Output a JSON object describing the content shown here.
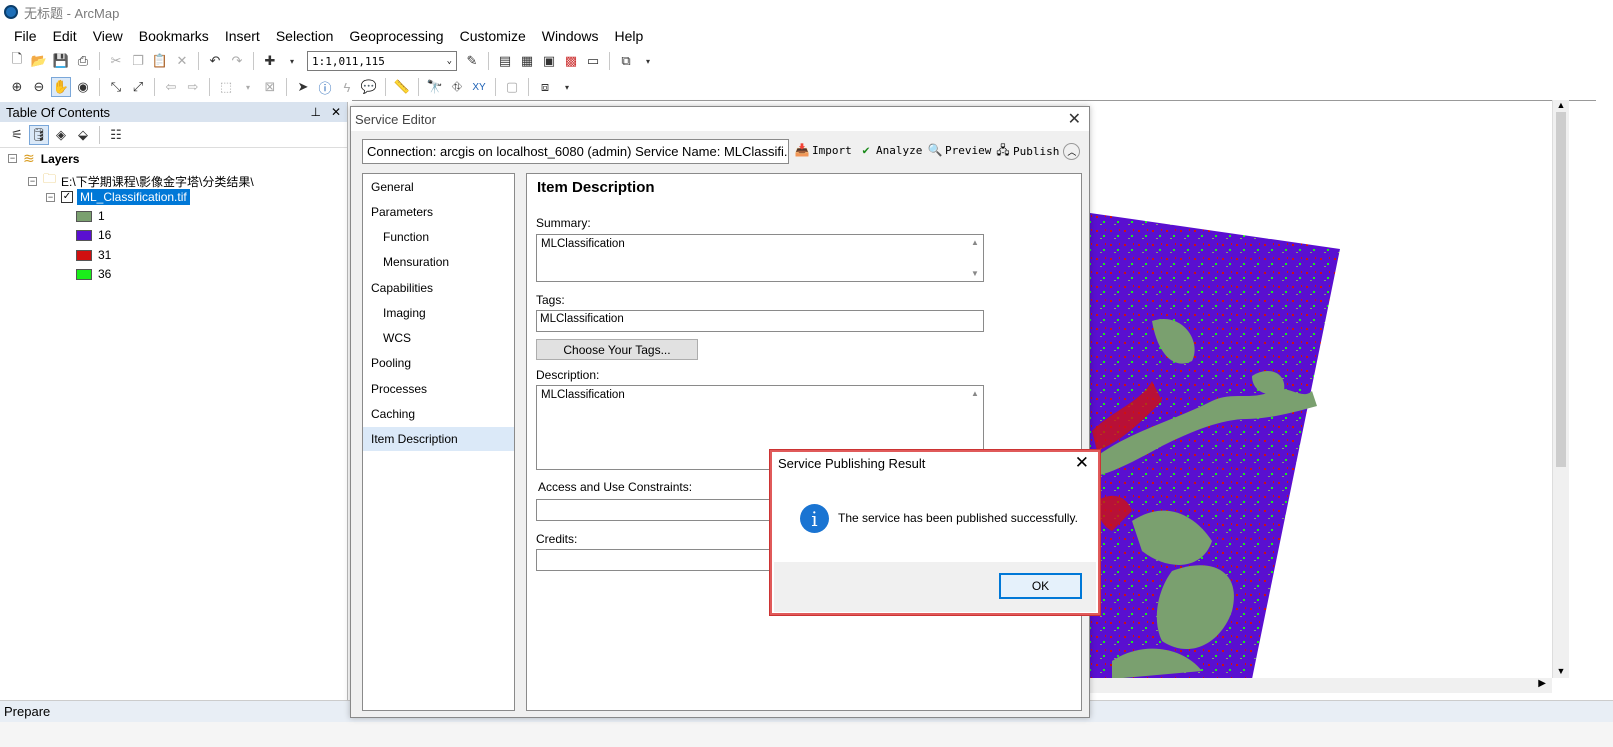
{
  "window": {
    "title": "无标题 - ArcMap"
  },
  "menu": [
    "File",
    "Edit",
    "View",
    "Bookmarks",
    "Insert",
    "Selection",
    "Geoprocessing",
    "Customize",
    "Windows",
    "Help"
  ],
  "toolbar": {
    "scale": "1:1,011,115"
  },
  "toc": {
    "title": "Table Of Contents",
    "layers_label": "Layers",
    "folder": "E:\\下学期课程\\影像金字塔\\分类结果\\",
    "layer": "ML_Classification.tif",
    "classes": [
      {
        "label": "1",
        "color": "#7aa06f"
      },
      {
        "label": "16",
        "color": "#5a0fd0"
      },
      {
        "label": "31",
        "color": "#d01010"
      },
      {
        "label": "36",
        "color": "#1aee1a"
      }
    ]
  },
  "service_editor": {
    "title": "Service Editor",
    "connection": "Connection: arcgis on localhost_6080 (admin)   Service Name: MLClassifi...",
    "actions": {
      "import": "Import",
      "analyze": "Analyze",
      "preview": "Preview",
      "publish": "Publish"
    },
    "nav": [
      "General",
      "Parameters",
      "Function",
      "Mensuration",
      "Capabilities",
      "Imaging",
      "WCS",
      "Pooling",
      "Processes",
      "Caching",
      "Item Description"
    ],
    "section_title": "Item Description",
    "summary_label": "Summary:",
    "summary_value": "MLClassification",
    "tags_label": "Tags:",
    "tags_value": "MLClassification",
    "choose_tags": "Choose Your Tags...",
    "description_label": "Description:",
    "description_value": "MLClassification",
    "constraints_label": "Access and Use Constraints:",
    "credits_label": "Credits:"
  },
  "message_box": {
    "title": "Service Publishing Result",
    "text": "The service has been published successfully.",
    "ok": "OK"
  },
  "status": {
    "text": "Prepare"
  },
  "map_colors": {
    "land": "#7aa06f",
    "water": "#5a0fd0",
    "urban": "#d01010",
    "veg": "#1aee1a"
  }
}
